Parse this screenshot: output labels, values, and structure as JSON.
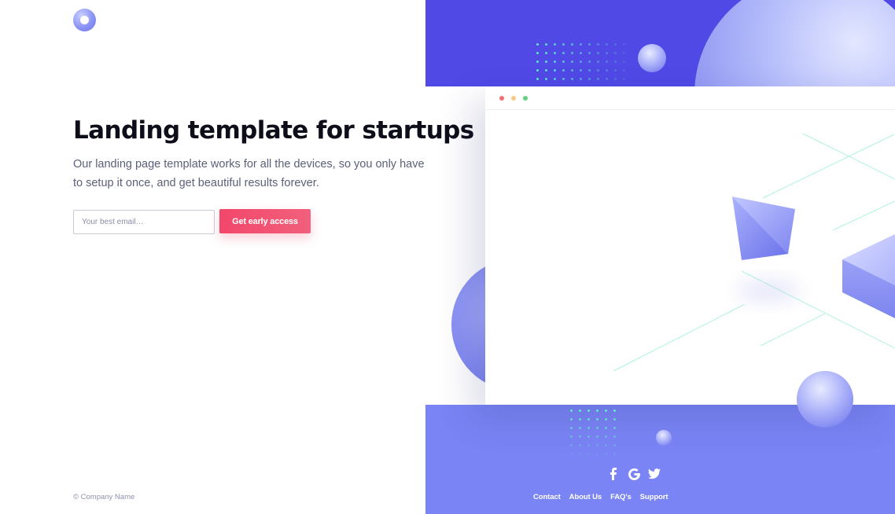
{
  "hero": {
    "title": "Landing template for startups",
    "paragraph": "Our landing page template works for all the devices, so you only have to setup it once, and get beautiful results forever."
  },
  "signup": {
    "email_placeholder": "Your best email…",
    "cta_label": "Get early access"
  },
  "footer": {
    "copyright": "© Company Name",
    "links": [
      "Contact",
      "About Us",
      "FAQ's",
      "Support"
    ],
    "social_icons": [
      "facebook-icon",
      "google-icon",
      "twitter-icon"
    ]
  },
  "colors": {
    "primary": "#5049e6",
    "secondary": "#7a84f4",
    "accent": "#f2476a",
    "dots": "#5ef1c4",
    "text": "#0d0e1a",
    "muted": "#5b6079"
  }
}
